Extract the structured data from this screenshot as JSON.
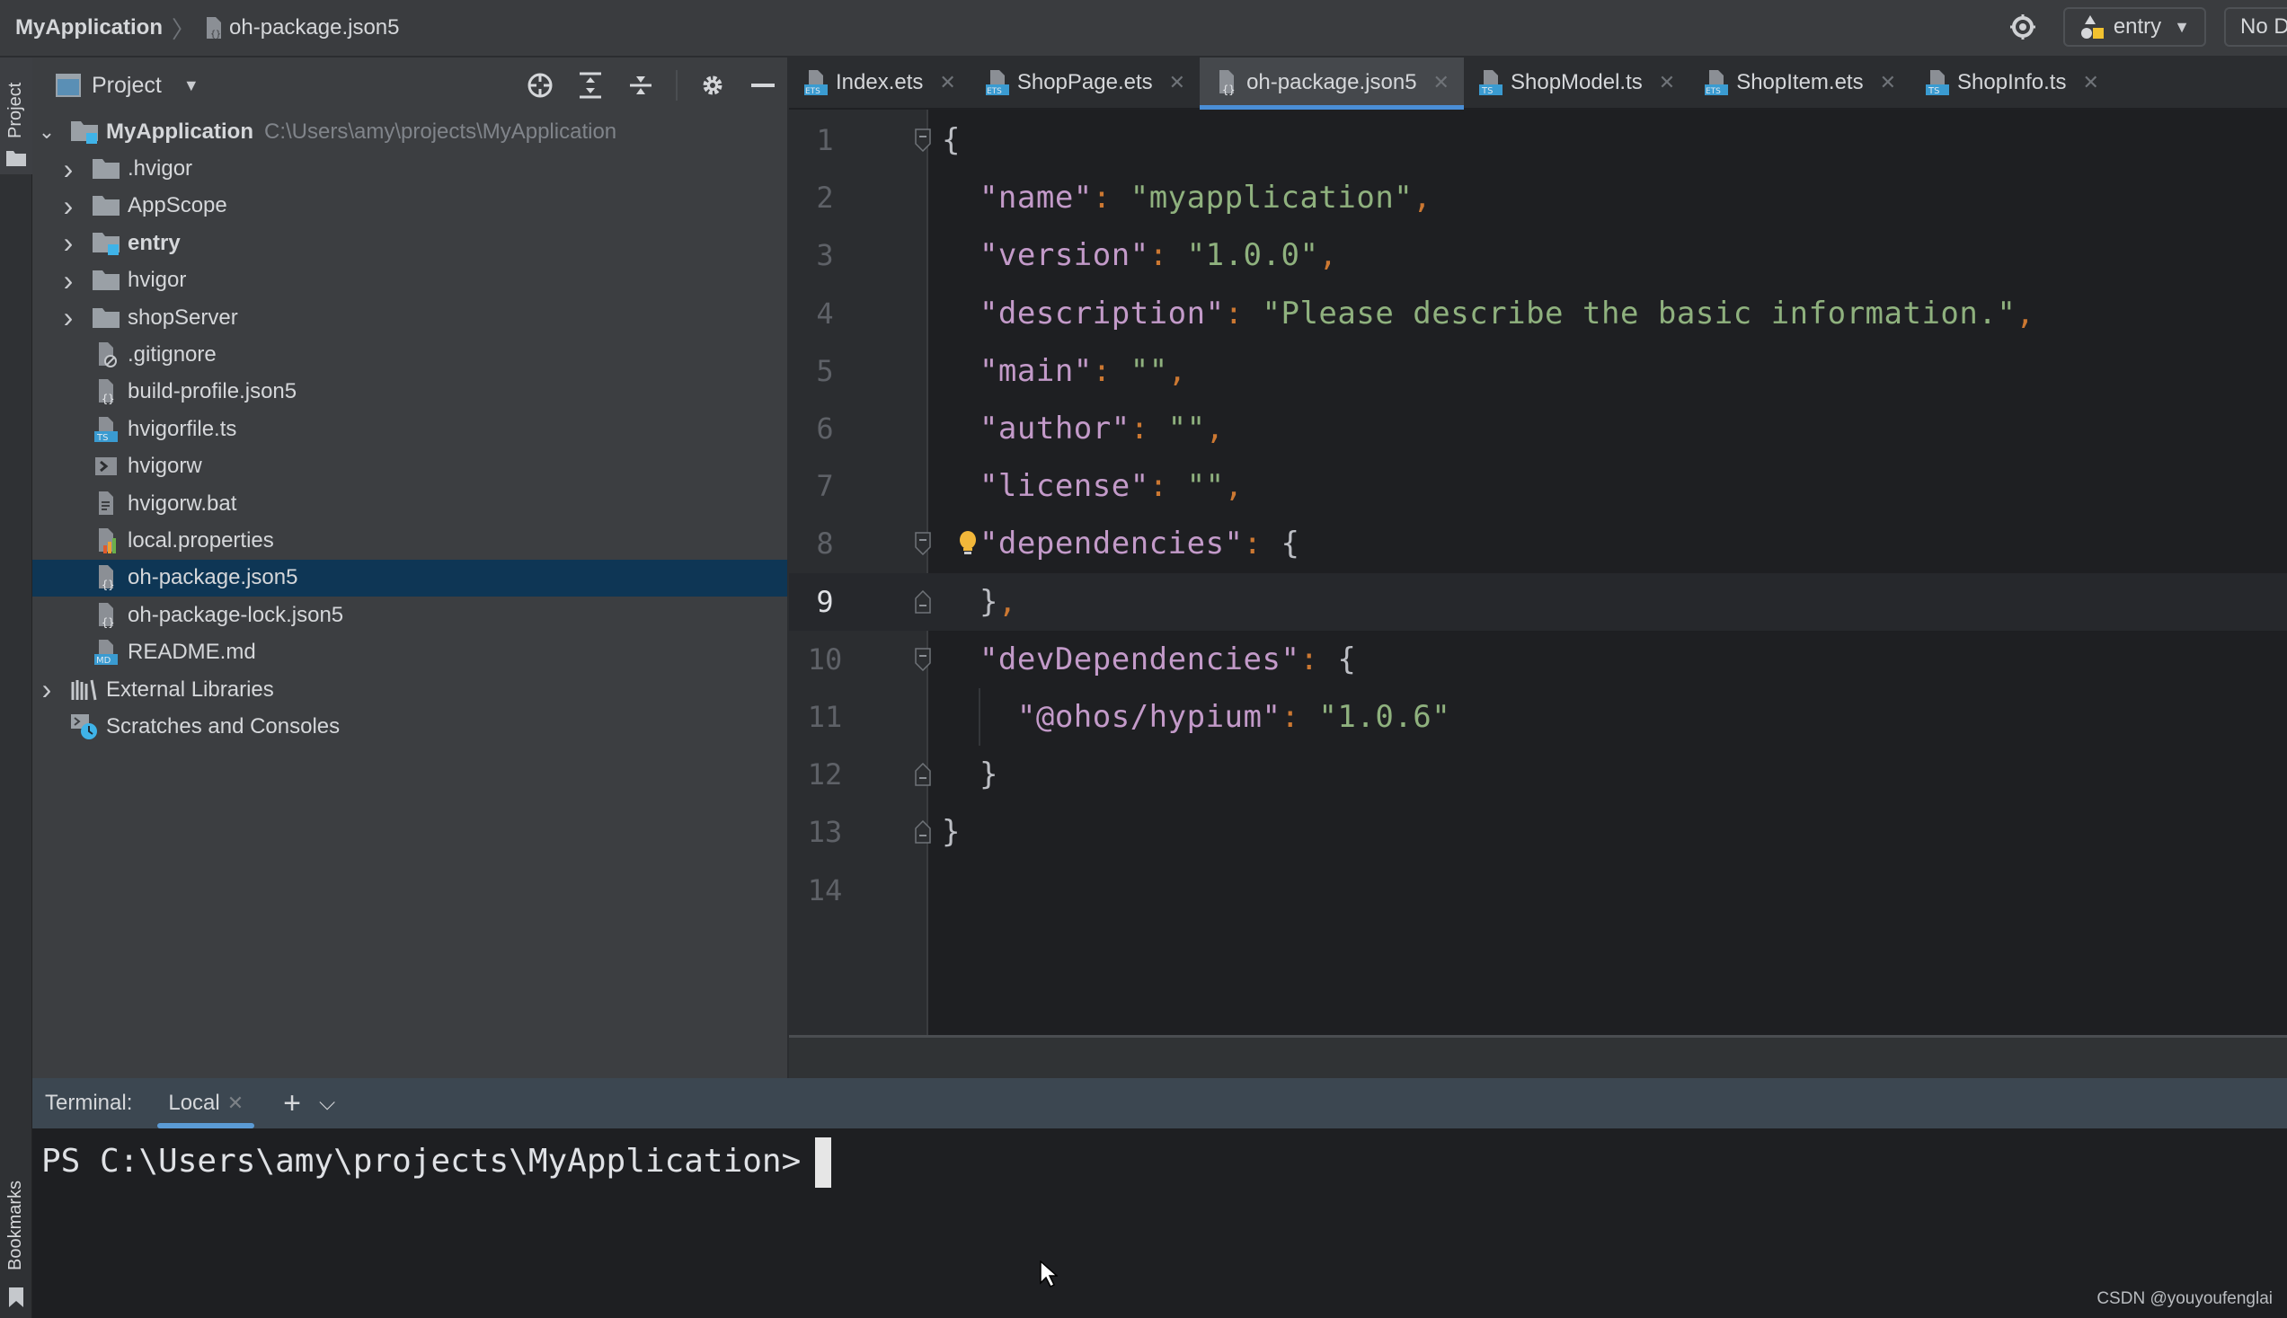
{
  "topbar": {
    "project_name": "MyApplication",
    "breadcrumb_file": "oh-package.json5",
    "run_config": "entry",
    "device": "No Devices"
  },
  "stripe": {
    "project_label": "Project",
    "bookmarks_label": "Bookmarks"
  },
  "project_panel": {
    "title": "Project",
    "tree": [
      {
        "label": "MyApplication",
        "path": "C:\\Users\\amy\\projects\\MyApplication",
        "type": "module-root",
        "expanded": true,
        "bold": true
      },
      {
        "label": ".hvigor",
        "type": "folder",
        "expanded": false
      },
      {
        "label": "AppScope",
        "type": "folder",
        "expanded": false
      },
      {
        "label": "entry",
        "type": "module",
        "expanded": false,
        "bold": true
      },
      {
        "label": "hvigor",
        "type": "folder",
        "expanded": false
      },
      {
        "label": "shopServer",
        "type": "folder",
        "expanded": false
      },
      {
        "label": ".gitignore",
        "type": "ignore-file"
      },
      {
        "label": "build-profile.json5",
        "type": "json-file"
      },
      {
        "label": "hvigorfile.ts",
        "type": "ts-file"
      },
      {
        "label": "hvigorw",
        "type": "shell-file"
      },
      {
        "label": "hvigorw.bat",
        "type": "text-file"
      },
      {
        "label": "local.properties",
        "type": "properties-file"
      },
      {
        "label": "oh-package.json5",
        "type": "json-file",
        "selected": true
      },
      {
        "label": "oh-package-lock.json5",
        "type": "json-file"
      },
      {
        "label": "README.md",
        "type": "md-file"
      },
      {
        "label": "External Libraries",
        "type": "libraries",
        "expanded": false
      },
      {
        "label": "Scratches and Consoles",
        "type": "scratches"
      }
    ]
  },
  "editor": {
    "tabs": [
      {
        "label": "Index.ets",
        "type": "ets",
        "active": false
      },
      {
        "label": "ShopPage.ets",
        "type": "ets",
        "active": false
      },
      {
        "label": "oh-package.json5",
        "type": "json",
        "active": true
      },
      {
        "label": "ShopModel.ts",
        "type": "ts",
        "active": false
      },
      {
        "label": "ShopItem.ets",
        "type": "ets",
        "active": false
      },
      {
        "label": "ShopInfo.ts",
        "type": "ts",
        "active": false
      }
    ],
    "current_line": 9,
    "lines": [
      {
        "n": "1",
        "tokens": [
          [
            "b",
            "{"
          ]
        ]
      },
      {
        "n": "2",
        "tokens": [
          [
            "b",
            "  "
          ],
          [
            "k",
            "\"name\""
          ],
          [
            "p",
            ": "
          ],
          [
            "s",
            "\"myapplication\""
          ],
          [
            "p",
            ","
          ]
        ]
      },
      {
        "n": "3",
        "tokens": [
          [
            "b",
            "  "
          ],
          [
            "k",
            "\"version\""
          ],
          [
            "p",
            ": "
          ],
          [
            "s",
            "\"1.0.0\""
          ],
          [
            "p",
            ","
          ]
        ]
      },
      {
        "n": "4",
        "tokens": [
          [
            "b",
            "  "
          ],
          [
            "k",
            "\"description\""
          ],
          [
            "p",
            ": "
          ],
          [
            "s",
            "\"Please describe the basic information.\""
          ],
          [
            "p",
            ","
          ]
        ]
      },
      {
        "n": "5",
        "tokens": [
          [
            "b",
            "  "
          ],
          [
            "k",
            "\"main\""
          ],
          [
            "p",
            ": "
          ],
          [
            "s",
            "\"\""
          ],
          [
            "p",
            ","
          ]
        ]
      },
      {
        "n": "6",
        "tokens": [
          [
            "b",
            "  "
          ],
          [
            "k",
            "\"author\""
          ],
          [
            "p",
            ": "
          ],
          [
            "s",
            "\"\""
          ],
          [
            "p",
            ","
          ]
        ]
      },
      {
        "n": "7",
        "tokens": [
          [
            "b",
            "  "
          ],
          [
            "k",
            "\"license\""
          ],
          [
            "p",
            ": "
          ],
          [
            "s",
            "\"\""
          ],
          [
            "p",
            ","
          ]
        ]
      },
      {
        "n": "8",
        "tokens": [
          [
            "b",
            "  "
          ],
          [
            "k",
            "\"dependencies\""
          ],
          [
            "p",
            ": "
          ],
          [
            "b",
            "{"
          ]
        ]
      },
      {
        "n": "9",
        "tokens": [
          [
            "b",
            "  }"
          ],
          [
            "p",
            ","
          ]
        ]
      },
      {
        "n": "10",
        "tokens": [
          [
            "b",
            "  "
          ],
          [
            "k",
            "\"devDependencies\""
          ],
          [
            "p",
            ": "
          ],
          [
            "b",
            "{"
          ]
        ]
      },
      {
        "n": "11",
        "tokens": [
          [
            "b",
            "    "
          ],
          [
            "k",
            "\"@ohos/hypium\""
          ],
          [
            "p",
            ": "
          ],
          [
            "s",
            "\"1.0.6\""
          ]
        ]
      },
      {
        "n": "12",
        "tokens": [
          [
            "b",
            "  }"
          ]
        ]
      },
      {
        "n": "13",
        "tokens": [
          [
            "b",
            "}"
          ]
        ]
      },
      {
        "n": "14",
        "tokens": []
      }
    ],
    "colors": {
      "key": "#c39ac9",
      "string": "#8fb17e",
      "punctuation": "#cc7832",
      "brace": "#bcbec4"
    }
  },
  "terminal": {
    "label": "Terminal:",
    "tab": "Local",
    "prompt": "PS C:\\Users\\amy\\projects\\MyApplication>"
  },
  "watermark": "CSDN @youyoufenglai"
}
